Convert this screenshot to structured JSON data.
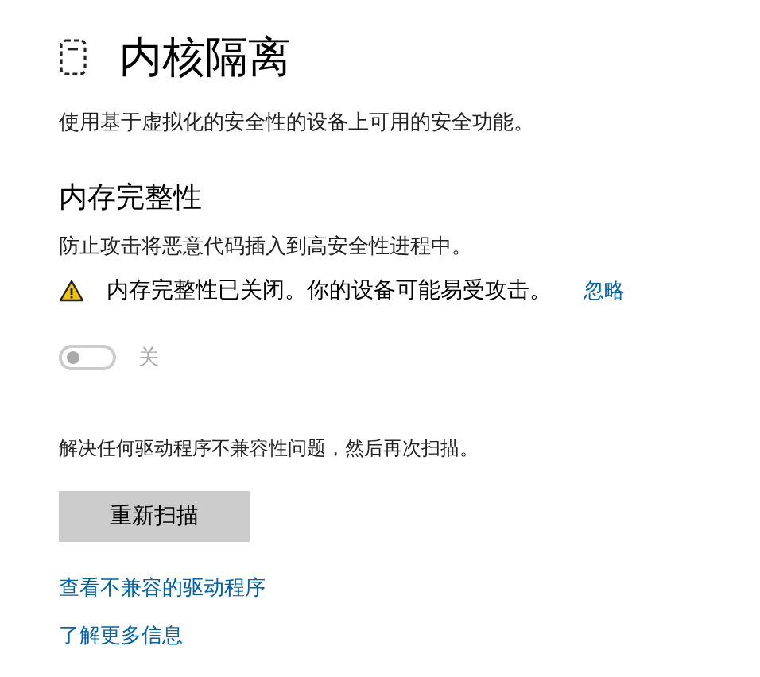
{
  "page": {
    "title": "内核隔离",
    "description": "使用基于虚拟化的安全性的设备上可用的安全功能。"
  },
  "section": {
    "heading": "内存完整性",
    "description": "防止攻击将恶意代码插入到高安全性进程中。",
    "warning": {
      "message": "内存完整性已关闭。你的设备可能易受攻击。",
      "action": "忽略"
    },
    "toggle": {
      "on": false,
      "disabled": true,
      "label": "关"
    }
  },
  "resolve_text": "解决任何驱动程序不兼容性问题，然后再次扫描。",
  "rescan_button": "重新扫描",
  "links": [
    "查看不兼容的驱动程序",
    "了解更多信息"
  ]
}
